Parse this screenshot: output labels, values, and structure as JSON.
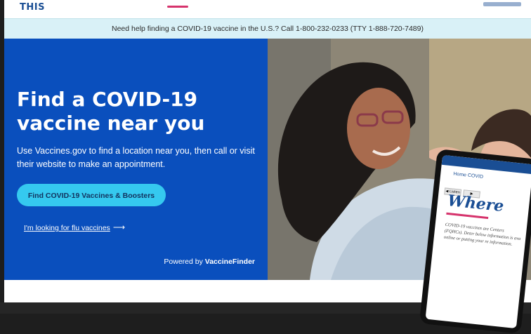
{
  "header": {
    "logo_text": "THIS"
  },
  "banner": {
    "text": "Need help finding a COVID-19 vaccine in the U.S.? Call 1-800-232-0233 (TTY 1-888-720-7489)"
  },
  "hero": {
    "title": "Find a COVID-19 vaccine near you",
    "subtitle": "Use Vaccines.gov to find a location near you, then call or visit their website to make an appointment.",
    "cta_label": "Find COVID-19 Vaccines & Boosters",
    "flu_link": "I'm looking for flu vaccines",
    "flu_arrow": "⟶",
    "powered_prefix": "Powered by",
    "powered_brand": "VaccineFinder"
  },
  "tablet": {
    "crumb": "Home  COVID",
    "btn_left": "◀ Listen",
    "btn_right": "▶",
    "title": "Where",
    "text": "COVID-19 vaccines are Centers (FQHCs). Deter below information is ava online or putting your re information."
  },
  "colors": {
    "hero_bg": "#0a4fbd",
    "cta_bg": "#35c9ef",
    "banner_bg": "#d9f1f7",
    "accent": "#d6336c"
  }
}
